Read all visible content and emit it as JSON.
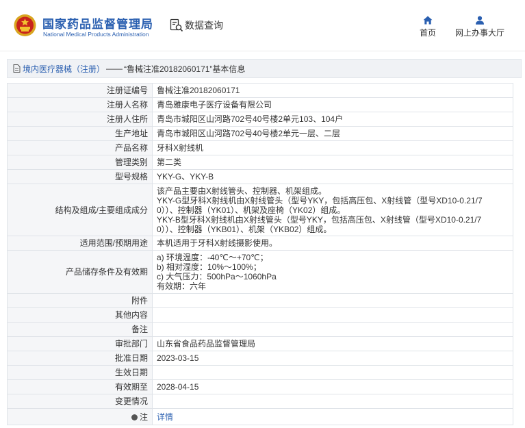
{
  "header": {
    "org_name_cn": "国家药品监督管理局",
    "org_name_en": "National Medical Products Administration",
    "data_query": "数据查询",
    "nav": {
      "home": "首页",
      "service_hall": "网上办事大厅"
    }
  },
  "breadcrumb": {
    "category": "境内医疗器械（注册）",
    "separator": "——",
    "title": "“鲁械注准20182060171”基本信息"
  },
  "colors": {
    "brand": "#2a5fb0",
    "label_bg": "#f5f6f8",
    "crumb_bg": "#f0f2f5"
  },
  "record": {
    "reg_no": {
      "label": "注册证编号",
      "value": "鲁械注准20182060171"
    },
    "registrant": {
      "label": "注册人名称",
      "value": "青岛雅康电子医疗设备有限公司"
    },
    "reg_address": {
      "label": "注册人住所",
      "value": "青岛市城阳区山河路702号40号楼2单元103、104户"
    },
    "prod_address": {
      "label": "生产地址",
      "value": "青岛市城阳区山河路702号40号楼2单元一层、二层"
    },
    "product_name": {
      "label": "产品名称",
      "value": "牙科X射线机"
    },
    "mgmt_class": {
      "label": "管理类别",
      "value": "第二类"
    },
    "model": {
      "label": "型号规格",
      "value": "YKY-G、YKY-B"
    },
    "structure": {
      "label": "结构及组成/主要组成成分",
      "lines": [
        "该产品主要由X射线管头、控制器、机架组成。",
        "YKY-G型牙科X射线机由X射线管头（型号YKY，包括高压包、X射线管（型号XD10-0.21/7",
        "0））、控制器（YK01）、机架及座椅（YK02）组成。",
        "YKY-B型牙科X射线机由X射线管头（型号YKY，包括高压包、X射线管（型号XD10-0.21/7",
        "0））、控制器（YKB01）、机架（YKB02）组成。"
      ]
    },
    "scope": {
      "label": "适用范围/预期用途",
      "value": "本机适用于牙科X射线摄影使用。"
    },
    "storage": {
      "label": "产品储存条件及有效期",
      "lines": [
        "a) 环境温度：-40℃～+70℃；",
        "b) 相对湿度：10%～100%；",
        "c) 大气压力：500hPa～1060hPa",
        "有效期：六年"
      ]
    },
    "attachment": {
      "label": "附件",
      "value": ""
    },
    "other": {
      "label": "其他内容",
      "value": ""
    },
    "remark": {
      "label": "备注",
      "value": ""
    },
    "approval_dept": {
      "label": "审批部门",
      "value": "山东省食品药品监督管理局"
    },
    "approval_date": {
      "label": "批准日期",
      "value": "2023-03-15"
    },
    "effective_date": {
      "label": "生效日期",
      "value": ""
    },
    "valid_until": {
      "label": "有效期至",
      "value": "2028-04-15"
    },
    "change": {
      "label": "变更情况",
      "value": ""
    },
    "note": {
      "label": "注",
      "value": "详情"
    }
  }
}
